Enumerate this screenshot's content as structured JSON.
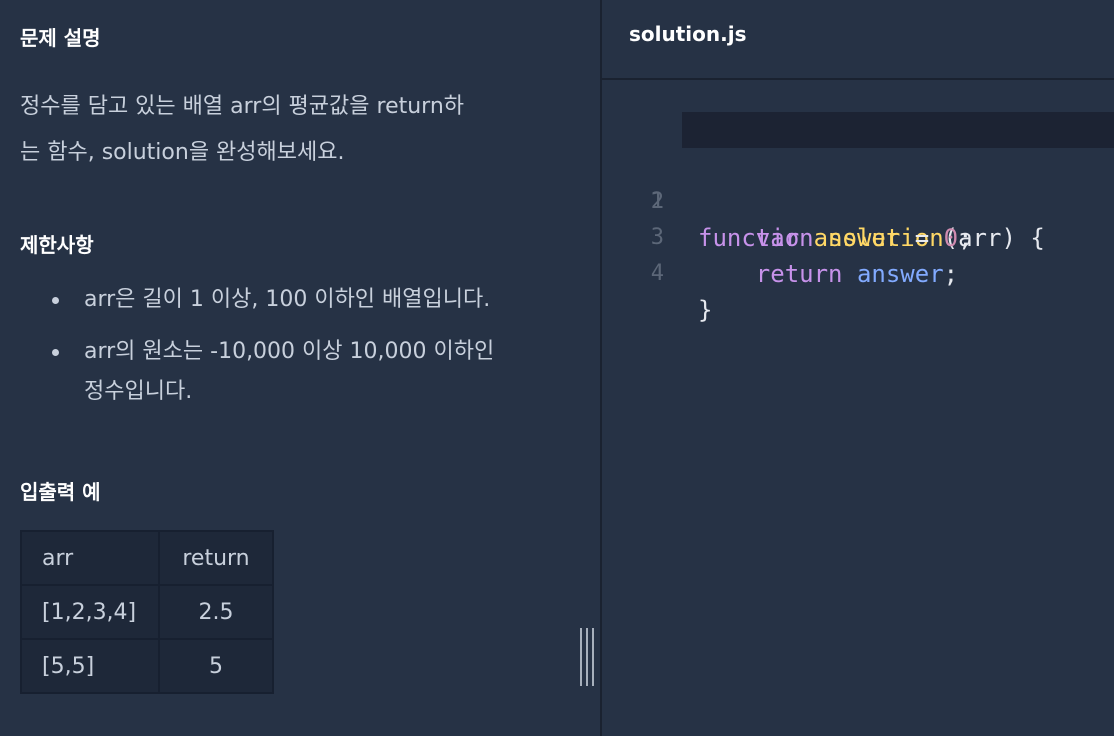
{
  "problem": {
    "description_title": "문제 설명",
    "description_lines": [
      "정수를 담고 있는 배열 arr의 평균값을 return하",
      "는 함수, solution을 완성해보세요."
    ],
    "constraints_title": "제한사항",
    "constraints": [
      "arr은 길이 1 이상, 100 이하인 배열입니다.",
      "arr의 원소는 -10,000 이상 10,000 이하인 정수입니다."
    ],
    "constraint2_lines": [
      "arr의 원소는 -10,000 이상 10,000 이하인",
      "정수입니다."
    ],
    "examples_title": "입출력 예",
    "examples_table": {
      "headers": [
        "arr",
        "return"
      ],
      "rows": [
        [
          "[1,2,3,4]",
          "2.5"
        ],
        [
          "[5,5]",
          "5"
        ]
      ]
    }
  },
  "editor": {
    "filename": "solution.js",
    "line_numbers": [
      "1",
      "2",
      "3",
      "4"
    ],
    "code": {
      "l1": {
        "kw": "function",
        "fn": "solution",
        "open": "(",
        "param": "arr",
        "close": ") {"
      },
      "l2": {
        "indent": "    ",
        "kw": "var",
        "var": "answer",
        "eq": " = ",
        "num": "0",
        "semi": ";"
      },
      "l3": {
        "indent": "    ",
        "kw": "return",
        "ref": "answer",
        "semi": ";"
      },
      "l4": {
        "brace": "}"
      }
    }
  }
}
